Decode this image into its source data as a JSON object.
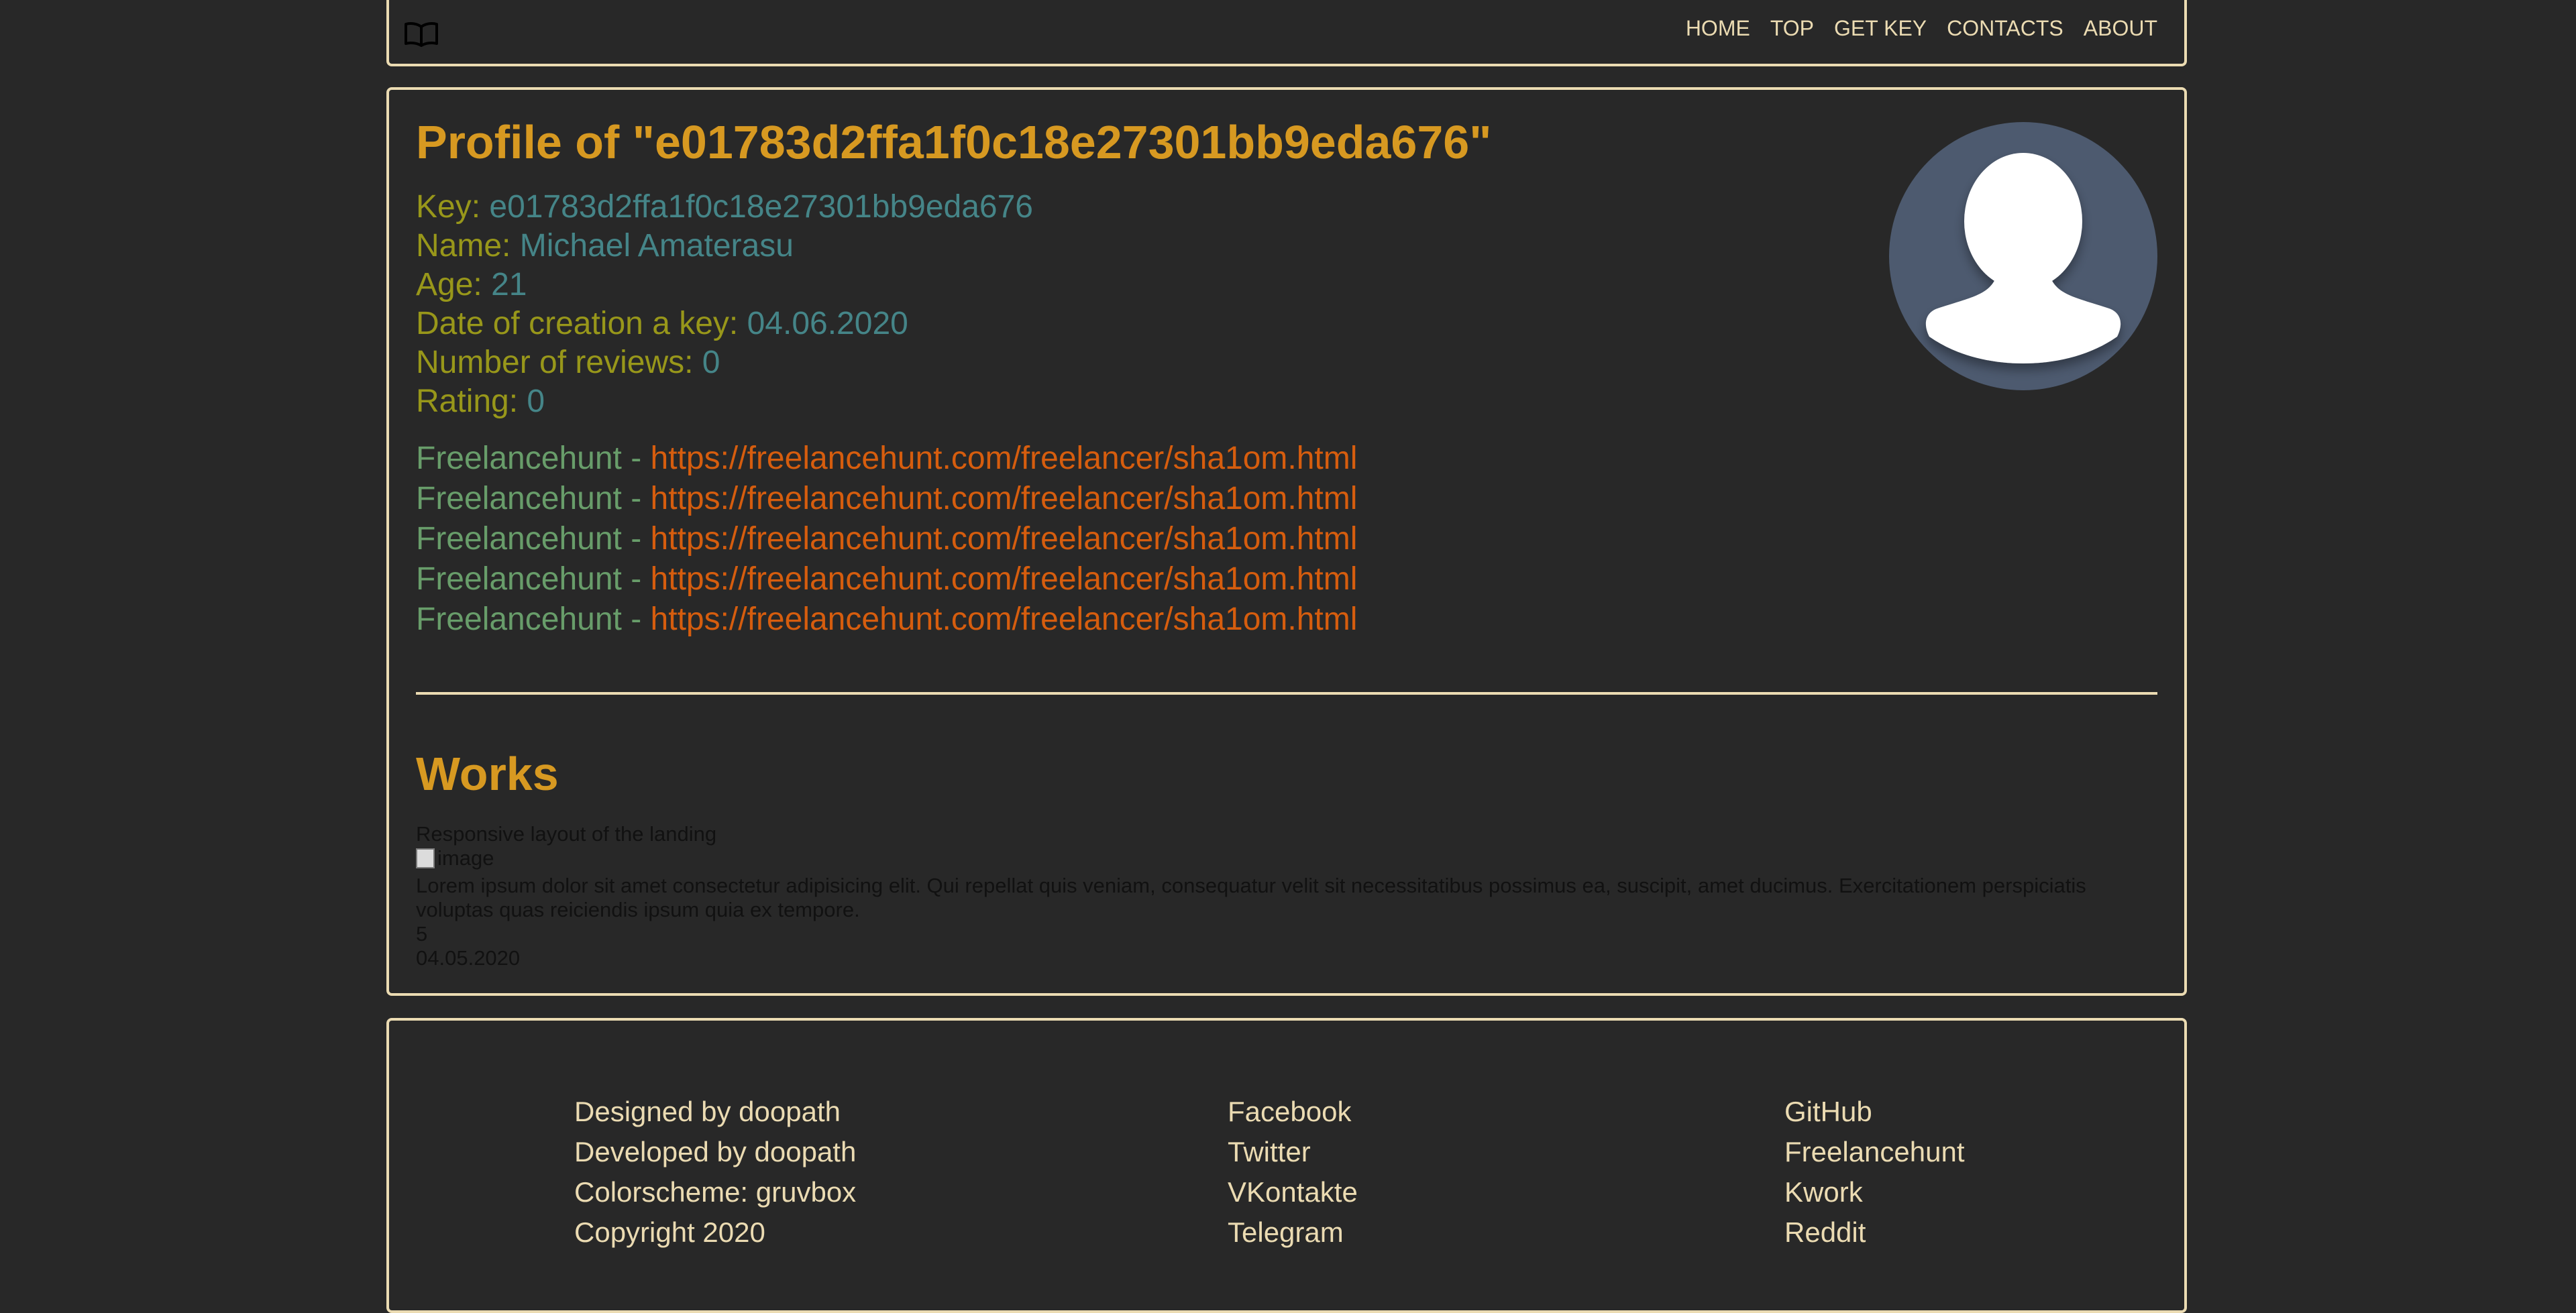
{
  "nav": {
    "items": [
      "HOME",
      "TOP",
      "GET KEY",
      "CONTACTS",
      "ABOUT"
    ]
  },
  "profile": {
    "title": "Profile of \"e01783d2ffa1f0c18e27301bb9eda676\"",
    "fields": [
      {
        "label": "Key: ",
        "value": "e01783d2ffa1f0c18e27301bb9eda676"
      },
      {
        "label": "Name: ",
        "value": "Michael Amaterasu"
      },
      {
        "label": "Age: ",
        "value": "21"
      },
      {
        "label": "Date of creation a key: ",
        "value": "04.06.2020"
      },
      {
        "label": "Number of reviews: ",
        "value": "0"
      },
      {
        "label": "Rating: ",
        "value": "0"
      }
    ],
    "links": [
      {
        "site": "Freelancehunt - ",
        "url": "https://freelancehunt.com/freelancer/sha1om.html"
      },
      {
        "site": "Freelancehunt - ",
        "url": "https://freelancehunt.com/freelancer/sha1om.html"
      },
      {
        "site": "Freelancehunt - ",
        "url": "https://freelancehunt.com/freelancer/sha1om.html"
      },
      {
        "site": "Freelancehunt - ",
        "url": "https://freelancehunt.com/freelancer/sha1om.html"
      },
      {
        "site": "Freelancehunt - ",
        "url": "https://freelancehunt.com/freelancer/sha1om.html"
      }
    ]
  },
  "works": {
    "title": "Works",
    "items": [
      {
        "name": "Responsive layout of the landing",
        "image_alt": "image",
        "description": "Lorem ipsum dolor sit amet consectetur adipisicing elit. Qui repellat quis veniam, consequatur velit sit necessitatibus possimus ea, suscipit, amet ducimus. Exercitationem perspiciatis voluptas quas reiciendis ipsum quia ex tempore.",
        "rating": "5",
        "date": "04.05.2020"
      }
    ]
  },
  "footer": {
    "col1": [
      "Designed by doopath",
      "Developed by doopath",
      "Colorscheme: gruvbox",
      "Copyright 2020"
    ],
    "col2": [
      "Facebook",
      "Twitter",
      "VKontakte",
      "Telegram"
    ],
    "col3": [
      "GitHub",
      "Freelancehunt",
      "Kwork",
      "Reddit"
    ]
  },
  "colors": {
    "background": "#282828",
    "border": "#ebdbb2",
    "title": "#d79921",
    "label": "#98971a",
    "value": "#458588",
    "link_site": "#689d6a",
    "link_url": "#d65d0e",
    "avatar_bg": "#4d5a6f"
  },
  "icons": {
    "logo": "open-book-icon",
    "avatar": "user-silhouette-icon",
    "broken_image": "broken-image-icon"
  }
}
